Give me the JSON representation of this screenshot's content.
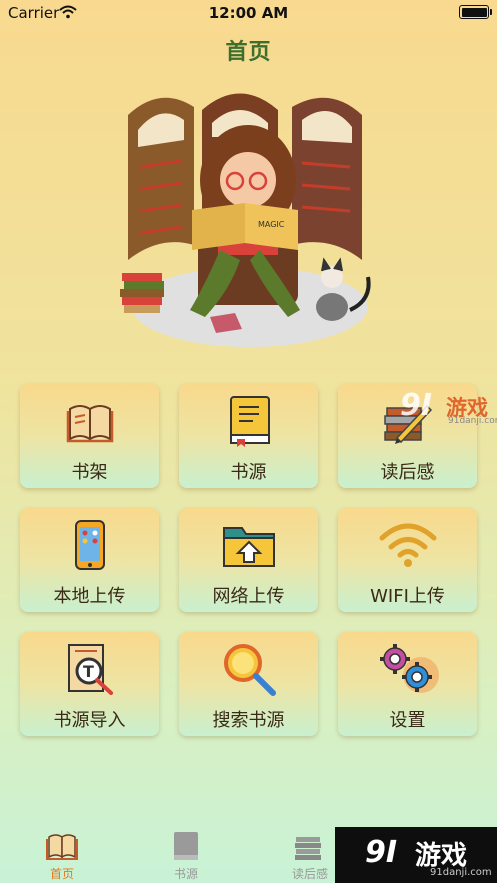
{
  "status_bar": {
    "carrier": "Carrier",
    "time": "12:00 AM"
  },
  "header": {
    "title": "首页"
  },
  "hero": {
    "book_text": "MAGIC"
  },
  "menu": [
    {
      "label": "书架",
      "icon": "open-book-icon"
    },
    {
      "label": "书源",
      "icon": "closed-book-icon"
    },
    {
      "label": "读后感",
      "icon": "book-pencil-icon"
    },
    {
      "label": "本地上传",
      "icon": "phone-icon"
    },
    {
      "label": "网络上传",
      "icon": "folder-upload-icon"
    },
    {
      "label": "WIFI上传",
      "icon": "wifi-icon"
    },
    {
      "label": "书源导入",
      "icon": "text-magnifier-icon"
    },
    {
      "label": "搜索书源",
      "icon": "search-icon"
    },
    {
      "label": "设置",
      "icon": "gear-icon"
    }
  ],
  "tab_bar": {
    "tabs": [
      {
        "label": "首页",
        "active": true
      },
      {
        "label": "书源",
        "active": false
      },
      {
        "label": "读后感",
        "active": false
      }
    ]
  },
  "watermark": {
    "logo": "9I",
    "name": "游戏",
    "url": "91danji.com"
  }
}
